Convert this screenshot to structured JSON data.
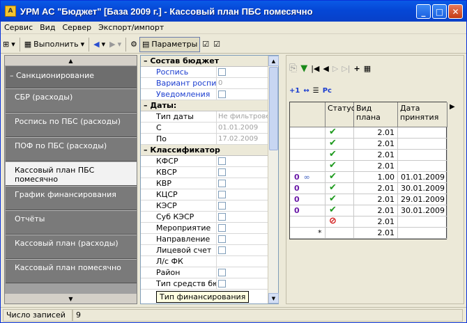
{
  "window": {
    "title": "УРМ АС \"Бюджет\" [База 2009 г.] - Кассовый план ПБС помесячно"
  },
  "menu": [
    "Сервис",
    "Вид",
    "Сервер",
    "Экспорт/импорт"
  ],
  "toolbar": {
    "execute_label": "Выполнить",
    "params_label": "Параметры"
  },
  "nav": {
    "header": "Санкционирование",
    "items": [
      "СБР (расходы)",
      "Роспись по ПБС (расходы)",
      "ПОФ по ПБС (расходы)",
      "Кассовый план ПБС помесячно",
      "График финансирования",
      "Отчёты",
      "Кассовый план (расходы)",
      "Кассовый план помесячно"
    ],
    "active_index": 3
  },
  "props": {
    "cat1": "Состав бюджет",
    "cat1_items": [
      "Роспись",
      "Вариант росписи",
      "Уведомления"
    ],
    "variant_value": "0",
    "cat2": "Даты:",
    "cat2_items": [
      "Тип даты",
      "С",
      "По"
    ],
    "cat2_values": [
      "Не фильтрове",
      "01.01.2009",
      "17.02.2009"
    ],
    "cat3": "Классификатор",
    "cat3_items": [
      "КФСР",
      "КВСР",
      "КВР",
      "КЦСР",
      "КЭСР",
      "Суб КЭСР",
      "Мероприятие",
      "Направление",
      "Лицевой счет",
      "Л/с ФК",
      "Район",
      "Тип средств бюд"
    ]
  },
  "tooltip": "Тип финансирования",
  "grid": {
    "col_status": "Статус",
    "col_kind": "Вид плана",
    "col_date": "Дата принятия",
    "rows": [
      {
        "status": "check",
        "kind": "2.01",
        "date": ""
      },
      {
        "status": "check",
        "kind": "2.01",
        "date": ""
      },
      {
        "status": "check",
        "kind": "2.01",
        "date": ""
      },
      {
        "status": "check",
        "kind": "2.01",
        "date": ""
      },
      {
        "status": "check",
        "kind": "1.00",
        "date": "01.01.2009",
        "mark": "0",
        "link": true
      },
      {
        "status": "check",
        "kind": "2.01",
        "date": "30.01.2009",
        "mark": "0"
      },
      {
        "status": "check",
        "kind": "2.01",
        "date": "29.01.2009",
        "mark": "0"
      },
      {
        "status": "check",
        "kind": "2.01",
        "date": "30.01.2009",
        "mark": "0"
      },
      {
        "status": "forbidden",
        "kind": "2.01",
        "date": ""
      },
      {
        "status": "",
        "kind": "2.01",
        "date": "",
        "new": "*"
      }
    ]
  },
  "status": {
    "label": "Число записей",
    "count": "9"
  }
}
